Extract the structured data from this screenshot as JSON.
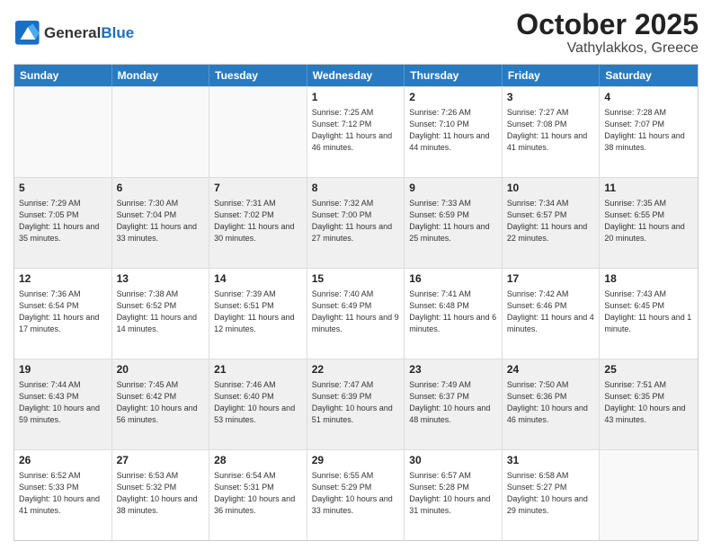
{
  "header": {
    "logo_general": "General",
    "logo_blue": "Blue",
    "month_title": "October 2025",
    "location": "Vathylakkos, Greece"
  },
  "days_of_week": [
    "Sunday",
    "Monday",
    "Tuesday",
    "Wednesday",
    "Thursday",
    "Friday",
    "Saturday"
  ],
  "weeks": [
    [
      {
        "day": "",
        "info": "",
        "empty": true
      },
      {
        "day": "",
        "info": "",
        "empty": true
      },
      {
        "day": "",
        "info": "",
        "empty": true
      },
      {
        "day": "1",
        "info": "Sunrise: 7:25 AM\nSunset: 7:12 PM\nDaylight: 11 hours and 46 minutes.",
        "empty": false
      },
      {
        "day": "2",
        "info": "Sunrise: 7:26 AM\nSunset: 7:10 PM\nDaylight: 11 hours and 44 minutes.",
        "empty": false
      },
      {
        "day": "3",
        "info": "Sunrise: 7:27 AM\nSunset: 7:08 PM\nDaylight: 11 hours and 41 minutes.",
        "empty": false
      },
      {
        "day": "4",
        "info": "Sunrise: 7:28 AM\nSunset: 7:07 PM\nDaylight: 11 hours and 38 minutes.",
        "empty": false
      }
    ],
    [
      {
        "day": "5",
        "info": "Sunrise: 7:29 AM\nSunset: 7:05 PM\nDaylight: 11 hours and 35 minutes.",
        "empty": false,
        "shaded": true
      },
      {
        "day": "6",
        "info": "Sunrise: 7:30 AM\nSunset: 7:04 PM\nDaylight: 11 hours and 33 minutes.",
        "empty": false,
        "shaded": true
      },
      {
        "day": "7",
        "info": "Sunrise: 7:31 AM\nSunset: 7:02 PM\nDaylight: 11 hours and 30 minutes.",
        "empty": false,
        "shaded": true
      },
      {
        "day": "8",
        "info": "Sunrise: 7:32 AM\nSunset: 7:00 PM\nDaylight: 11 hours and 27 minutes.",
        "empty": false,
        "shaded": true
      },
      {
        "day": "9",
        "info": "Sunrise: 7:33 AM\nSunset: 6:59 PM\nDaylight: 11 hours and 25 minutes.",
        "empty": false,
        "shaded": true
      },
      {
        "day": "10",
        "info": "Sunrise: 7:34 AM\nSunset: 6:57 PM\nDaylight: 11 hours and 22 minutes.",
        "empty": false,
        "shaded": true
      },
      {
        "day": "11",
        "info": "Sunrise: 7:35 AM\nSunset: 6:55 PM\nDaylight: 11 hours and 20 minutes.",
        "empty": false,
        "shaded": true
      }
    ],
    [
      {
        "day": "12",
        "info": "Sunrise: 7:36 AM\nSunset: 6:54 PM\nDaylight: 11 hours and 17 minutes.",
        "empty": false
      },
      {
        "day": "13",
        "info": "Sunrise: 7:38 AM\nSunset: 6:52 PM\nDaylight: 11 hours and 14 minutes.",
        "empty": false
      },
      {
        "day": "14",
        "info": "Sunrise: 7:39 AM\nSunset: 6:51 PM\nDaylight: 11 hours and 12 minutes.",
        "empty": false
      },
      {
        "day": "15",
        "info": "Sunrise: 7:40 AM\nSunset: 6:49 PM\nDaylight: 11 hours and 9 minutes.",
        "empty": false
      },
      {
        "day": "16",
        "info": "Sunrise: 7:41 AM\nSunset: 6:48 PM\nDaylight: 11 hours and 6 minutes.",
        "empty": false
      },
      {
        "day": "17",
        "info": "Sunrise: 7:42 AM\nSunset: 6:46 PM\nDaylight: 11 hours and 4 minutes.",
        "empty": false
      },
      {
        "day": "18",
        "info": "Sunrise: 7:43 AM\nSunset: 6:45 PM\nDaylight: 11 hours and 1 minute.",
        "empty": false
      }
    ],
    [
      {
        "day": "19",
        "info": "Sunrise: 7:44 AM\nSunset: 6:43 PM\nDaylight: 10 hours and 59 minutes.",
        "empty": false,
        "shaded": true
      },
      {
        "day": "20",
        "info": "Sunrise: 7:45 AM\nSunset: 6:42 PM\nDaylight: 10 hours and 56 minutes.",
        "empty": false,
        "shaded": true
      },
      {
        "day": "21",
        "info": "Sunrise: 7:46 AM\nSunset: 6:40 PM\nDaylight: 10 hours and 53 minutes.",
        "empty": false,
        "shaded": true
      },
      {
        "day": "22",
        "info": "Sunrise: 7:47 AM\nSunset: 6:39 PM\nDaylight: 10 hours and 51 minutes.",
        "empty": false,
        "shaded": true
      },
      {
        "day": "23",
        "info": "Sunrise: 7:49 AM\nSunset: 6:37 PM\nDaylight: 10 hours and 48 minutes.",
        "empty": false,
        "shaded": true
      },
      {
        "day": "24",
        "info": "Sunrise: 7:50 AM\nSunset: 6:36 PM\nDaylight: 10 hours and 46 minutes.",
        "empty": false,
        "shaded": true
      },
      {
        "day": "25",
        "info": "Sunrise: 7:51 AM\nSunset: 6:35 PM\nDaylight: 10 hours and 43 minutes.",
        "empty": false,
        "shaded": true
      }
    ],
    [
      {
        "day": "26",
        "info": "Sunrise: 6:52 AM\nSunset: 5:33 PM\nDaylight: 10 hours and 41 minutes.",
        "empty": false
      },
      {
        "day": "27",
        "info": "Sunrise: 6:53 AM\nSunset: 5:32 PM\nDaylight: 10 hours and 38 minutes.",
        "empty": false
      },
      {
        "day": "28",
        "info": "Sunrise: 6:54 AM\nSunset: 5:31 PM\nDaylight: 10 hours and 36 minutes.",
        "empty": false
      },
      {
        "day": "29",
        "info": "Sunrise: 6:55 AM\nSunset: 5:29 PM\nDaylight: 10 hours and 33 minutes.",
        "empty": false
      },
      {
        "day": "30",
        "info": "Sunrise: 6:57 AM\nSunset: 5:28 PM\nDaylight: 10 hours and 31 minutes.",
        "empty": false
      },
      {
        "day": "31",
        "info": "Sunrise: 6:58 AM\nSunset: 5:27 PM\nDaylight: 10 hours and 29 minutes.",
        "empty": false
      },
      {
        "day": "",
        "info": "",
        "empty": true
      }
    ]
  ]
}
